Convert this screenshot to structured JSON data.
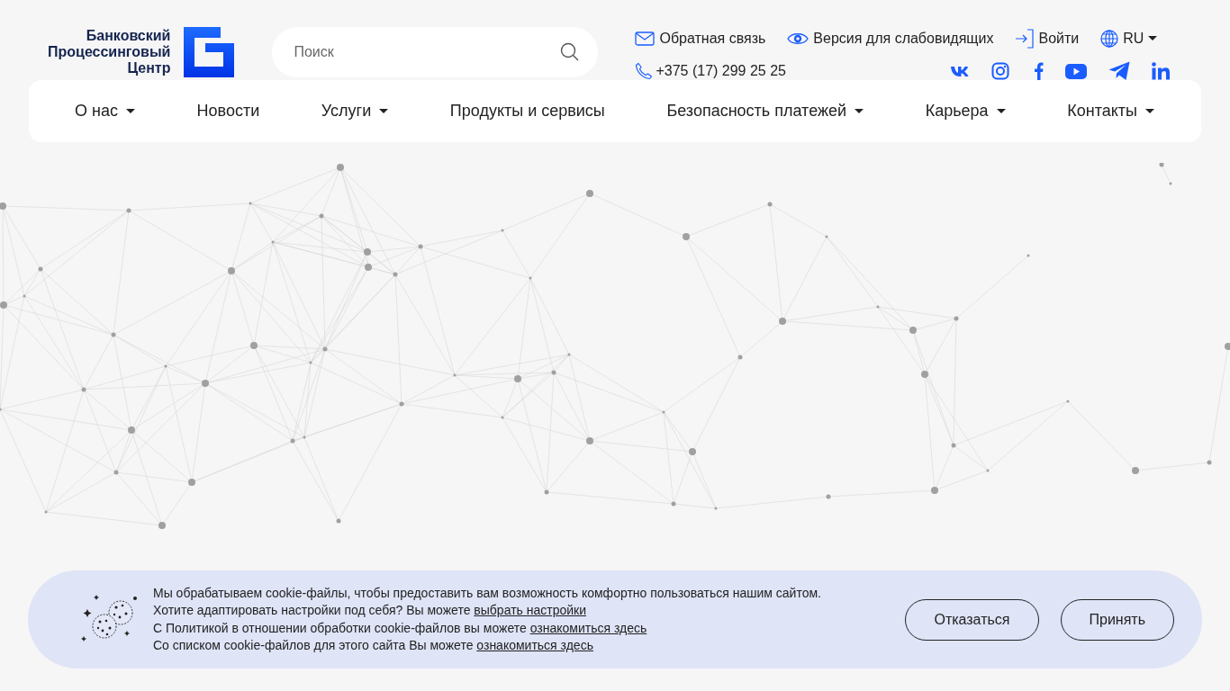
{
  "logo": {
    "lines": [
      "Банковский",
      "Процессинговый",
      "Центр"
    ]
  },
  "search": {
    "placeholder": "Поиск"
  },
  "top_links": [
    {
      "kind": "feedback",
      "label": "Обратная связь"
    },
    {
      "kind": "accessibility",
      "label": "Версия для слабовидящих"
    },
    {
      "kind": "login",
      "label": "Войти"
    },
    {
      "kind": "language",
      "label": "RU"
    }
  ],
  "phone": "+375 (17) 299 25 25",
  "nav": [
    {
      "label": "О нас",
      "dropdown": true
    },
    {
      "label": "Новости",
      "dropdown": false
    },
    {
      "label": "Услуги",
      "dropdown": true
    },
    {
      "label": "Продукты и сервисы",
      "dropdown": false
    },
    {
      "label": "Безопасность платежей",
      "dropdown": true
    },
    {
      "label": "Карьера",
      "dropdown": true
    },
    {
      "label": "Контакты",
      "dropdown": true
    }
  ],
  "cookie_banner": {
    "lines": [
      {
        "text": "Мы обрабатываем cookie-файлы, чтобы предоставить вам возможность комфортно пользоваться нашим сайтом."
      },
      {
        "text": "Хотите адаптировать настройки под себя? Вы можете ",
        "link": "выбрать настройки"
      },
      {
        "text": "С Политикой в отношении обработки cookie-файлов вы можете ",
        "link": "ознакомиться здесь"
      },
      {
        "text": "Со списком cookie-файлов для этого сайта Вы можете ",
        "link": "ознакомиться здесь"
      }
    ],
    "buttons": [
      "Отказаться",
      "Принять"
    ]
  }
}
